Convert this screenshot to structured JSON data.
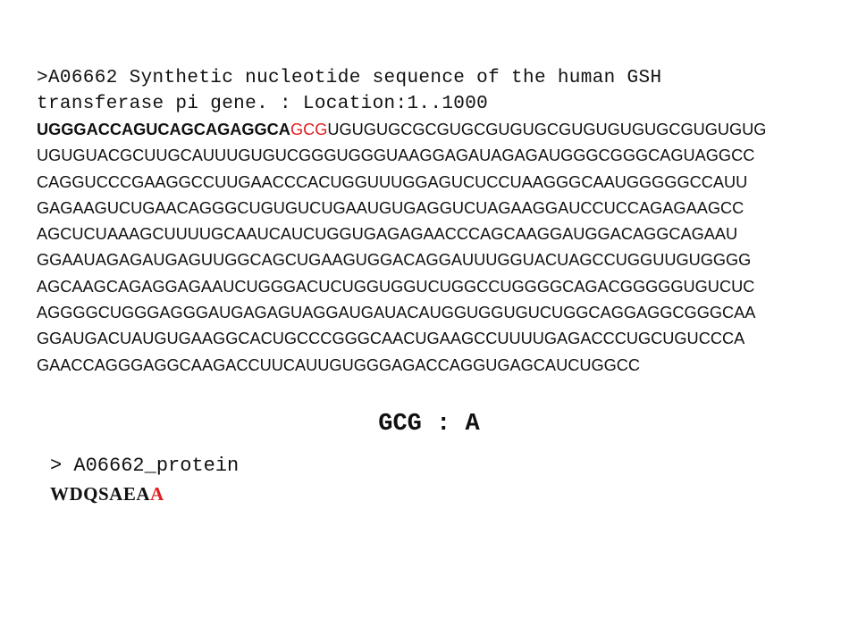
{
  "sequence": {
    "header_line1": ">A06662 Synthetic nucleotide sequence of the human GSH",
    "header_line2": "transferase pi gene. : Location:1..1000",
    "first_line": {
      "bold_prefix": "UGGGACCAGUCAGCAGAGGCA",
      "highlight_codon": "GCG",
      "rest": "UGUGUGCGCGUGCGUGUGCGUGUGUGUGCGUGUGUG"
    },
    "lines": [
      "UGUGUACGCUUGCAUUUGUGUCGGGUGGGUAAGGAGAUAGAGAUGGGCGGGCAGUAGGCC",
      "CAGGUCCCGAAGGCCUUGAACCCACUGGUUUGGAGUCUCCUAAGGGCAAUGGGGGCCAUU",
      "GAGAAGUCUGAACAGGGCUGUGUCUGAAUGUGAGGUCUAGAAGGAUCCUCCAGAGAAGCC",
      "AGCUCUAAAGCUUUUGCAAUCAUCUGGUGAGAGAACCCAGCAAGGAUGGACAGGCAGAAU",
      "GGAAUAGAGAUGAGUUGGCAGCUGAAGUGGACAGGAUUUGGUACUAGCCUGGUUGUGGGG",
      "AGCAAGCAGAGGAGAAUCUGGGACUCUGGUGGUCUGGCCUGGGGCAGACGGGGGUGUCUC",
      "AGGGGCUGGGAGGGAUGAGAGUAGGAUGAUACAUGGUGGUGUCUGGCAGGAGGCGGGCAA",
      "GGAUGACUAUGUGAAGGCACUGCCCGGGCAACUGAAGCCUUUUGAGACCCUGCUGUCCCA",
      "GAACCAGGGAGGCAAGACCUUCAUUGUGGGAGACCAGGUGAGCAUCUGGCC"
    ]
  },
  "codon_translation": {
    "codon": "GCG",
    "separator": ":",
    "amino_acid": "A"
  },
  "protein": {
    "header_prefix": ">",
    "header_name": "A06662_protein",
    "sequence_prefix": "WDQSAEA",
    "sequence_highlight": "A"
  },
  "colors": {
    "highlight": "#e02020",
    "text": "#111111"
  }
}
